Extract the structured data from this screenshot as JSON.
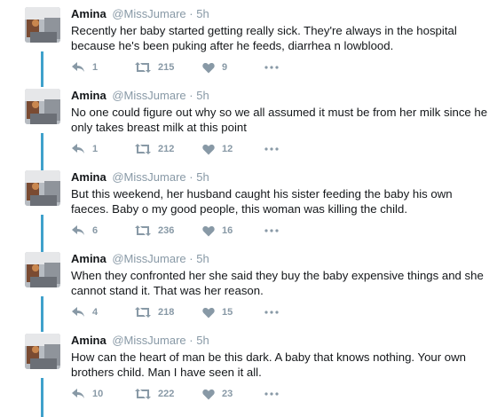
{
  "tweets": [
    {
      "name": "Amina",
      "handle": "@MissJumare",
      "dot": "·",
      "time": "5h",
      "text": "Recently her baby started getting really sick. They're always in the hospital because he's been puking after he feeds, diarrhea n lowblood.",
      "replies": "1",
      "retweets": "215",
      "likes": "9"
    },
    {
      "name": "Amina",
      "handle": "@MissJumare",
      "dot": "·",
      "time": "5h",
      "text": "No one could figure out why so we all assumed it must be from her milk since he only takes breast milk at this point",
      "replies": "1",
      "retweets": "212",
      "likes": "12"
    },
    {
      "name": "Amina",
      "handle": "@MissJumare",
      "dot": "·",
      "time": "5h",
      "text": "But this weekend, her husband caught his sister feeding the baby his own faeces. Baby o my good people, this woman was killing the child.",
      "replies": "6",
      "retweets": "236",
      "likes": "16"
    },
    {
      "name": "Amina",
      "handle": "@MissJumare",
      "dot": "·",
      "time": "5h",
      "text": "When they confronted her she said they buy the baby expensive things and she cannot stand it. That was her reason.",
      "replies": "4",
      "retweets": "218",
      "likes": "15"
    },
    {
      "name": "Amina",
      "handle": "@MissJumare",
      "dot": "·",
      "time": "5h",
      "text": "How can the heart of man be this dark. A baby that knows nothing. Your own brothers child. Man I have seen it all.",
      "replies": "10",
      "retweets": "222",
      "likes": "23"
    }
  ],
  "icons": {
    "reply": "reply-icon",
    "retweet": "retweet-icon",
    "like": "heart-icon",
    "more": "more-dots-icon"
  },
  "colors": {
    "thread_line": "#3fa1cb",
    "muted": "#8899a6",
    "text": "#14171a"
  }
}
